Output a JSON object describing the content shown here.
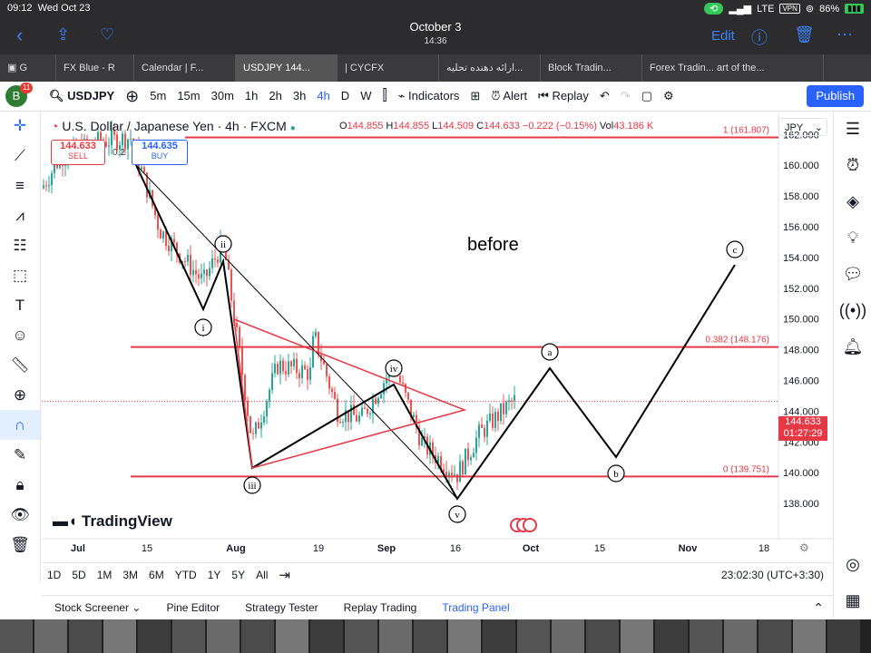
{
  "status": {
    "time": "09:12",
    "date": "Wed Oct 23",
    "signal": "LTE",
    "vpn": "VPN",
    "battery": "86%"
  },
  "nav": {
    "title": "October 3",
    "subtitle": "14:36",
    "edit": "Edit"
  },
  "tabs": [
    {
      "label": "FX Blue - R"
    },
    {
      "label": "Calendar | F..."
    },
    {
      "label": "USDJPY 144...",
      "active": true
    },
    {
      "label": "| CYCFX"
    },
    {
      "label": "ارائه دهنده تحلیه..."
    },
    {
      "label": "Block Tradin..."
    },
    {
      "label": "Forex Tradin... art of the..."
    }
  ],
  "toolbar": {
    "avatar": "B",
    "avatar_badge": "11",
    "symbol": "USDJPY",
    "intervals": [
      "5m",
      "15m",
      "30m",
      "1h",
      "2h",
      "3h",
      "4h",
      "D",
      "W"
    ],
    "active_interval": "4h",
    "indicators": "Indicators",
    "alert": "Alert",
    "replay": "Replay",
    "publish": "Publish"
  },
  "legend": {
    "title": "U.S. Dollar / Japanese Yen · 4h · FXCM",
    "o": "O",
    "o_val": "144.855",
    "h": "H",
    "h_val": "144.855",
    "l": "L",
    "l_val": "144.509",
    "c": "C",
    "c_val": "144.633",
    "chg": "−0.222 (−0.15%)",
    "vol": "Vol",
    "vol_val": "43.186 K",
    "sell_price": "144.633",
    "sell": "SELL",
    "spread": "0.2",
    "buy_price": "144.635",
    "buy": "BUY",
    "currency": "JPY"
  },
  "chart_data": {
    "type": "candlestick-with-drawings",
    "symbol": "USDJPY",
    "interval": "4h",
    "source": "FXCM",
    "y_ticks": [
      162,
      160,
      158,
      156,
      154,
      152,
      150,
      148,
      146,
      144,
      142,
      140,
      138
    ],
    "ylim": [
      137,
      163.5
    ],
    "x_ticks": [
      "Jul",
      "15",
      "Aug",
      "19",
      "Sep",
      "16",
      "Oct",
      "15",
      "Nov",
      "18"
    ],
    "current_price": "144.633",
    "countdown": "01:27:29",
    "fib_levels": [
      {
        "label": "1 (161.807)",
        "value": 161.807
      },
      {
        "label": "0.382 (148.176)",
        "value": 148.176
      },
      {
        "label": "0 (139.751)",
        "value": 139.751
      }
    ],
    "wave_labels": [
      "i",
      "ii",
      "iii",
      "iv",
      "v",
      "a",
      "b",
      "c"
    ],
    "annotation": "before",
    "watermark": "TradingView",
    "colors": {
      "up": "#26a69a",
      "down": "#ef5350",
      "fib": "#e53945",
      "wave": "#000000"
    }
  },
  "bottom": {
    "timeframes": [
      "1D",
      "5D",
      "1M",
      "3M",
      "6M",
      "YTD",
      "1Y",
      "5Y",
      "All"
    ],
    "clock": "23:02:30 (UTC+3:30)"
  },
  "panels": [
    "Stock Screener",
    "Pine Editor",
    "Strategy Tester",
    "Replay Trading",
    "Trading Panel"
  ],
  "panels_active": "Trading Panel"
}
